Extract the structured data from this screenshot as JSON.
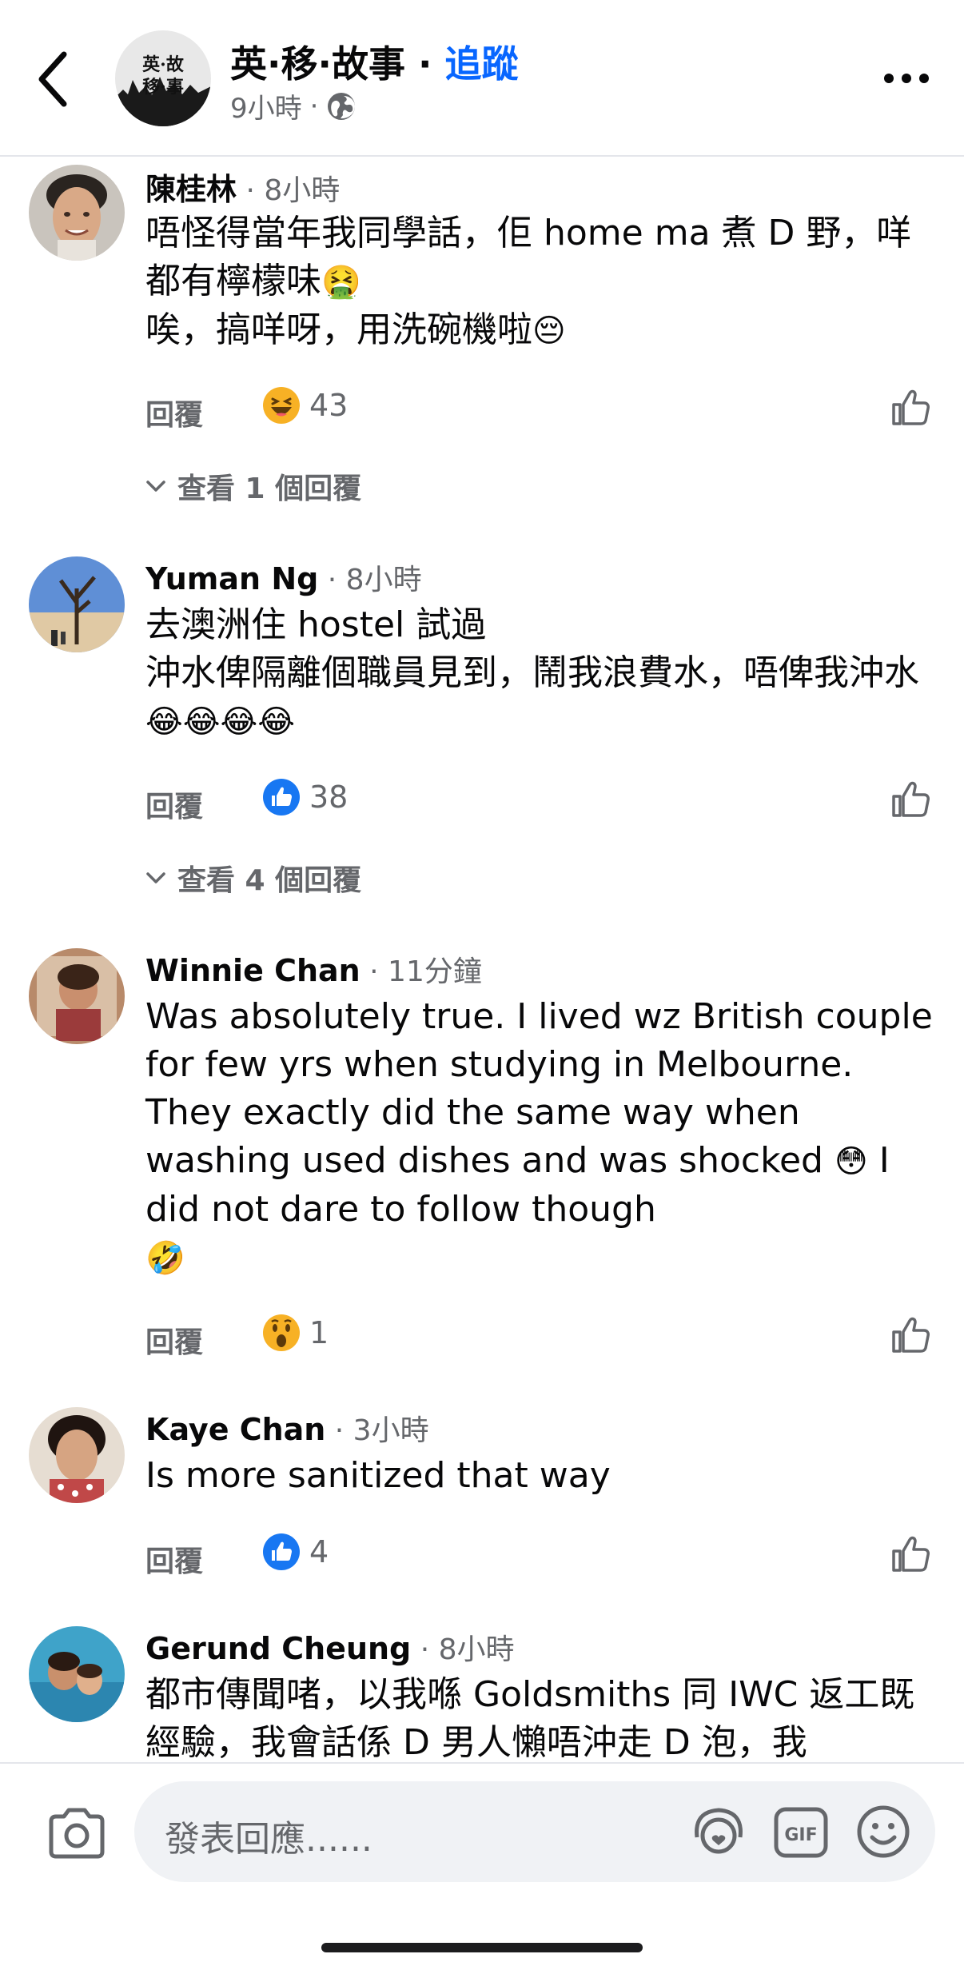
{
  "header": {
    "page_name": "英·移·故事",
    "separator": " · ",
    "follow_label": "追蹤",
    "post_time": "9小時",
    "dot": "·",
    "avatar_text_1": "英·故",
    "avatar_text_2": "移·事"
  },
  "comments": [
    {
      "name": "陳桂林",
      "time": " · 8小時",
      "text_1": "唔怪得當年我同學話，佢 home ma 煮 D 野，咩都有檸檬味",
      "emoji_1": "🤮",
      "text_2": "唉，搞咩呀，用洗碗機啦",
      "emoji_2": "😔",
      "reply_label": "回覆",
      "reaction_icon": "haha-reaction-icon",
      "reaction_count": "43",
      "view_replies": "查看 1 個回覆"
    },
    {
      "name": "Yuman Ng",
      "time": " · 8小時",
      "text_1": "去澳洲住 hostel 試過",
      "text_2": "沖水俾隔離個職員見到，鬧我浪費水，唔俾我沖水",
      "emoji_1": "😂😂😂😂",
      "reply_label": "回覆",
      "reaction_icon": "like-reaction-icon",
      "reaction_count": "38",
      "view_replies": "查看 4 個回覆"
    },
    {
      "name": "Winnie Chan",
      "time": " · 11分鐘",
      "text_1": "Was absolutely true.  I lived wz British couple for few yrs when studying in Melbourne.  They exactly did the same way when washing used dishes and was shocked",
      "emoji_1": "😳",
      "text_2": " I did not dare to follow though",
      "emoji_2": "🤣",
      "reply_label": "回覆",
      "reaction_icon": "wow-reaction-icon",
      "reaction_count": "1"
    },
    {
      "name": "Kaye Chan",
      "time": " · 3小時",
      "text_1": "Is more sanitized that way",
      "reply_label": "回覆",
      "reaction_icon": "like-reaction-icon",
      "reaction_count": "4"
    },
    {
      "name": "Gerund Cheung",
      "time": " · 8小時",
      "text_1": "都市傳聞啫，以我喺 Goldsmiths 同 IWC 返工既經驗，我會話係 D 男人懶唔沖走 D 泡，我"
    }
  ],
  "composer": {
    "placeholder": "發表回應......",
    "gif_label": "GIF"
  },
  "colors": {
    "accent": "#0866ff",
    "secondary_text": "#65676b",
    "divider": "#e4e6eb",
    "input_bg": "#f0f2f5"
  }
}
